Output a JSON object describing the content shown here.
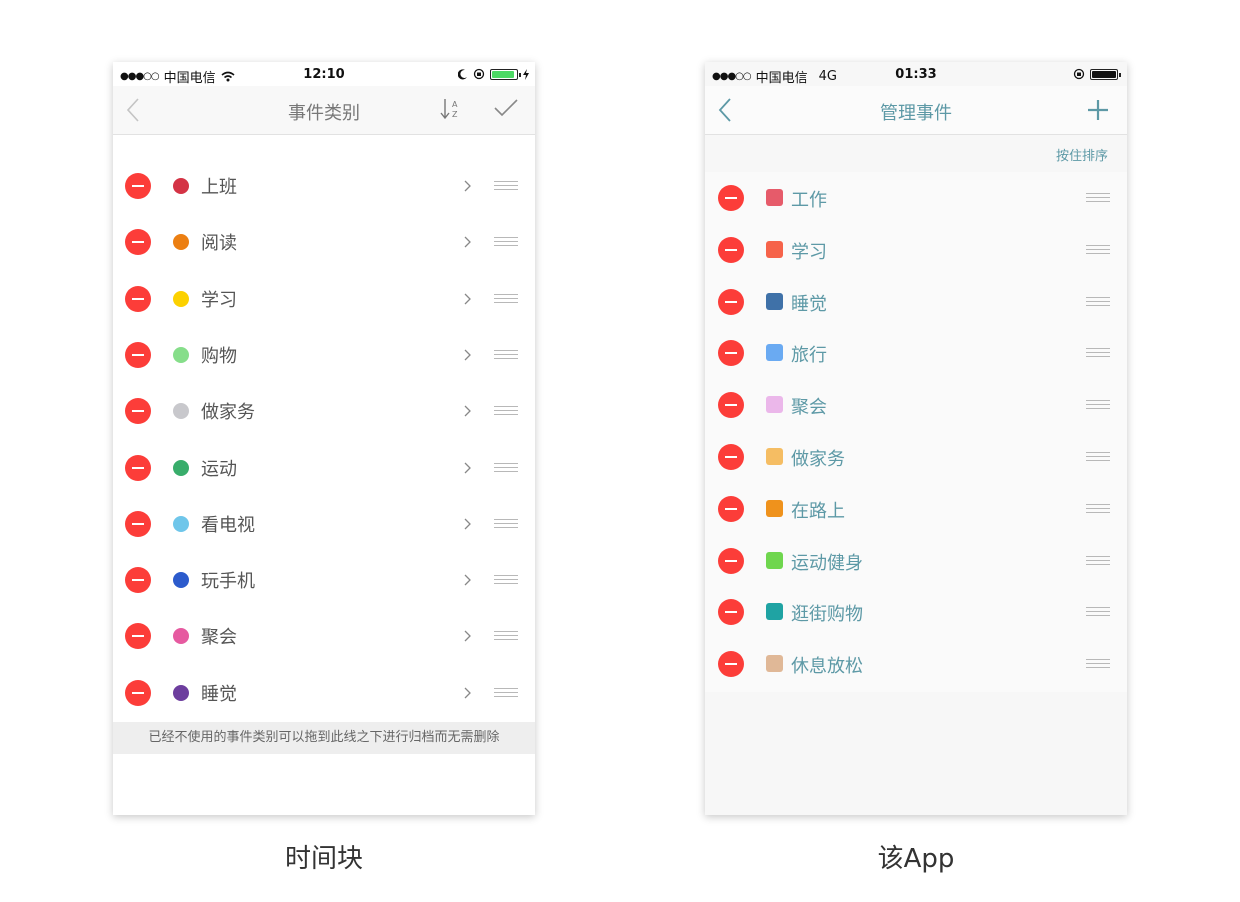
{
  "left_phone": {
    "status": {
      "carrier": "中国电信",
      "time": "12:10",
      "battery_color": "#4cd964"
    },
    "nav": {
      "title": "事件类别",
      "sort_icon": "sort-az-icon",
      "confirm_icon": "checkmark-icon"
    },
    "items": [
      {
        "label": "上班",
        "color": "#d43345"
      },
      {
        "label": "阅读",
        "color": "#ec7f12"
      },
      {
        "label": "学习",
        "color": "#fcd100"
      },
      {
        "label": "购物",
        "color": "#86de8a"
      },
      {
        "label": "做家务",
        "color": "#c8c8cc"
      },
      {
        "label": "运动",
        "color": "#38ad6b"
      },
      {
        "label": "看电视",
        "color": "#6fc6ea"
      },
      {
        "label": "玩手机",
        "color": "#2c5bcc"
      },
      {
        "label": "聚会",
        "color": "#e65aa0"
      },
      {
        "label": "睡觉",
        "color": "#6d3e9e"
      }
    ],
    "footer_note": "已经不使用的事件类别可以拖到此线之下进行归档而无需删除"
  },
  "right_phone": {
    "status": {
      "carrier": "中国电信",
      "network": "4G",
      "time": "01:33",
      "battery_color": "#111111"
    },
    "nav": {
      "title": "管理事件",
      "add_icon": "plus-icon"
    },
    "hint": "按住排序",
    "accent_color": "#5d99a6",
    "items": [
      {
        "label": "工作",
        "color": "#e65b6a"
      },
      {
        "label": "学习",
        "color": "#f6634a"
      },
      {
        "label": "睡觉",
        "color": "#3f71a8"
      },
      {
        "label": "旅行",
        "color": "#6aaaf2"
      },
      {
        "label": "聚会",
        "color": "#ebb7ea"
      },
      {
        "label": "做家务",
        "color": "#f5bd63"
      },
      {
        "label": "在路上",
        "color": "#ef921c"
      },
      {
        "label": "运动健身",
        "color": "#6fd64e"
      },
      {
        "label": "逛街购物",
        "color": "#1fa3a3"
      },
      {
        "label": "休息放松",
        "color": "#e0b897"
      }
    ]
  },
  "captions": {
    "left": "时间块",
    "right": "该App"
  }
}
